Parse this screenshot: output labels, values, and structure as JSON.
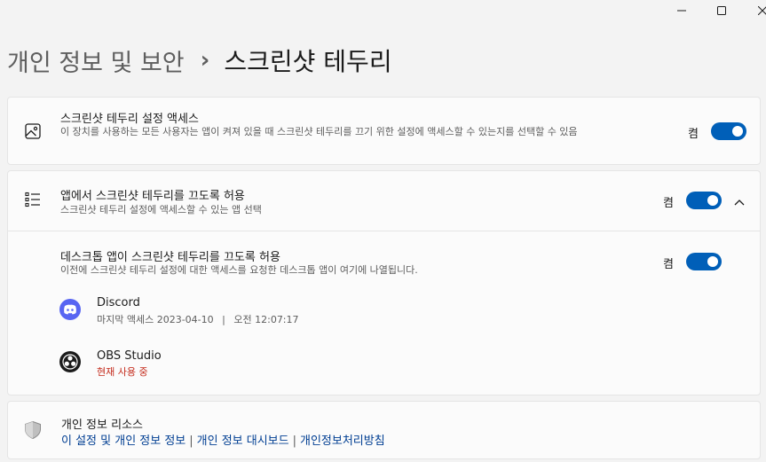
{
  "window_controls": {
    "minimize_icon": "minimize-icon",
    "maximize_icon": "maximize-icon",
    "close_icon": "close-icon"
  },
  "breadcrumb": {
    "parent": "개인 정보 및 보안",
    "separator": "›",
    "current": "스크린샷 테두리"
  },
  "access_card": {
    "icon": "screenshot-image-icon",
    "title": "스크린샷 테두리 설정 액세스",
    "description": "이 장치를 사용하는 모든 사용자는 앱이 켜져 있을 때 스크린샷 테두리를 끄기 위한 설정에 액세스할 수 있는지를 선택할 수 있음",
    "state_label": "켬",
    "toggle_on": true
  },
  "apps_card": {
    "icon": "checklist-icon",
    "title": "앱에서 스크린샷 테두리를 끄도록 허용",
    "description": "스크린샷 테두리 설정에 액세스할 수 있는 앱 선택",
    "state_label": "켬",
    "toggle_on": true,
    "expanded": true,
    "desktop": {
      "title": "데스크톱 앱이 스크린샷 테두리를 끄도록 허용",
      "description": "이전에 스크린샷 테두리 설정에 대한 액세스를 요청한 데스크톱 앱이 여기에 나열됩니다.",
      "state_label": "켬",
      "toggle_on": true,
      "apps": [
        {
          "name": "Discord",
          "last_access_label": "마지막 액세스",
          "date": "2023-04-10",
          "separator": "|",
          "time": "오전 12:07:17",
          "icon": "discord-icon",
          "icon_color": "#5865f2"
        },
        {
          "name": "OBS Studio",
          "status": "현재 사용 중",
          "icon": "obs-icon",
          "icon_color": "#1b1b1b",
          "status_color": "#c42b1c"
        }
      ]
    }
  },
  "privacy_card": {
    "icon": "shield-icon",
    "title": "개인 정보 리소스",
    "links": [
      "이 설정 및 개인 정보 정보",
      "개인 정보 대시보드",
      "개인정보처리방침"
    ],
    "link_separator": "|"
  },
  "colors": {
    "accent": "#005fb8",
    "background": "#f3f3f3",
    "card": "#fbfbfb",
    "link": "#003e92"
  }
}
